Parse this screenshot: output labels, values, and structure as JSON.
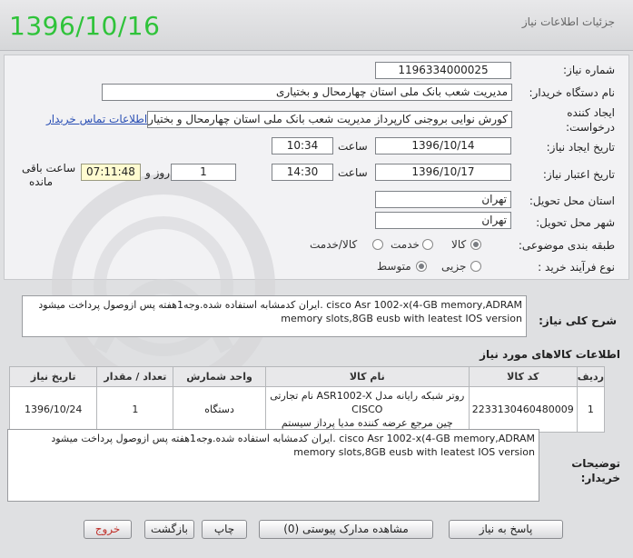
{
  "header": {
    "date": "1396/10/16",
    "title": "جزئیات اطلاعات نیاز"
  },
  "form": {
    "need_number_label": "شماره نیاز:",
    "need_number": "1196334000025",
    "buyer_org_label": "نام دستگاه خریدار:",
    "buyer_org": "مدیریت شعب بانک ملی استان چهارمحال و بختیاری",
    "creator_label_1": "ایجاد کننده",
    "creator_label_2": "درخواست:",
    "creator": "کورش نوایی بروجنی کارپرداز مدیریت شعب بانک ملی استان چهارمحال و بختیاری",
    "contact_link": "اطلاعات تماس خریدار",
    "created_date_label": "تاریخ ایجاد نیاز:",
    "created_date": "1396/10/14",
    "created_time_label": "ساعت",
    "created_time": "10:34",
    "valid_date_label": "تاریخ اعتبار نیاز:",
    "valid_date": "1396/10/17",
    "valid_time_label": "ساعت",
    "valid_time": "14:30",
    "days_value": "1",
    "days_label": "روز و",
    "remaining_time": "07:11:48",
    "remaining_label_1": "ساعت باقی",
    "remaining_label_2": "مانده",
    "province_label": "استان محل تحویل:",
    "province": "تهران",
    "city_label": "شهر محل تحویل:",
    "city": "تهران",
    "category_label": "طبقه بندی موضوعی:",
    "category_options": [
      "کالا",
      "خدمت",
      "کالا/خدمت"
    ],
    "category_selected": "کالا",
    "process_label": "نوع فرآیند خرید :",
    "process_options": [
      "جزیی",
      "متوسط"
    ],
    "process_selected": "متوسط"
  },
  "summary": {
    "label": "شرح کلی نیاز:",
    "line1": "ایران کدمشابه استفاده شده.وجه1هفته پس ازوصول پرداخت میشود. cisco Asr 1002-x(4-GB memory,ADRAM",
    "line2": "memory slots,8GB eusb with leatest IOS version"
  },
  "items_section": {
    "title": "اطلاعات کالاهای مورد نیاز",
    "columns": [
      "ردیف",
      "کد کالا",
      "نام کالا",
      "واحد شمارش",
      "تعداد / مقدار",
      "تاریخ نیاز"
    ],
    "rows": [
      {
        "row": "1",
        "code": "2233130460480009",
        "name_line1": "روتر شبکه رایانه مدل ASR1002-X نام تجارتی CISCO",
        "name_line2": "چین مرجع عرضه کننده مدیا پرداز سیستم",
        "unit": "دستگاه",
        "qty": "1",
        "date": "1396/10/24"
      }
    ]
  },
  "buyer_notes": {
    "label_1": "توضیحات",
    "label_2": "خریدار:",
    "line1": "ایران کدمشابه استفاده شده.وجه1هفته پس ازوصول پرداخت میشود. cisco Asr 1002-x(4-GB memory,ADRAM",
    "line2": "memory slots,8GB eusb with leatest IOS version"
  },
  "buttons": {
    "reply": "پاسخ به نیاز",
    "attachments": "مشاهده مدارک پیوستی (0)",
    "print": "چاپ",
    "back": "بازگشت",
    "exit": "خروج"
  },
  "colors": {
    "date_green": "#2fc33a",
    "link_blue": "#2a4fb4",
    "exit_red": "#c0302a"
  }
}
